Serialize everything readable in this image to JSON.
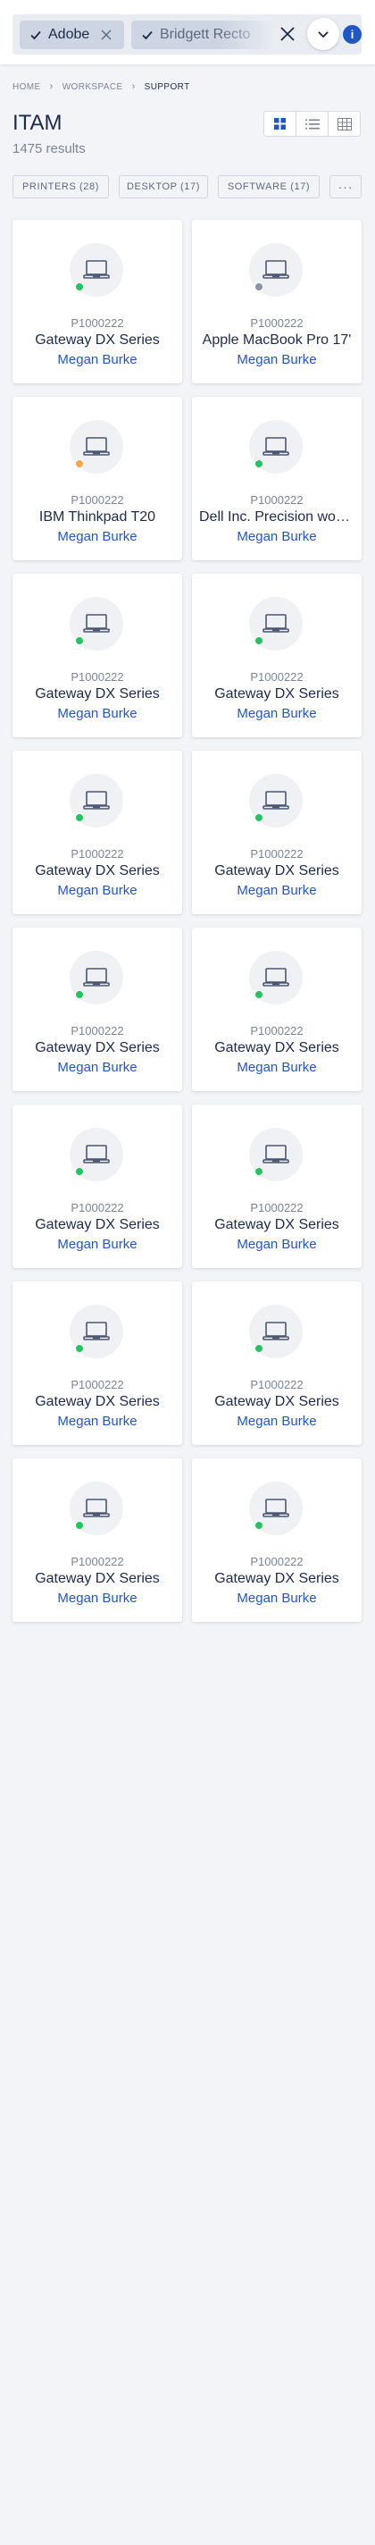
{
  "filters": {
    "chips": [
      {
        "label": "Adobe",
        "active": true
      },
      {
        "label": "Bridgett Recto",
        "active": true
      }
    ],
    "info_badge": "i",
    "icons": {
      "check": "check-icon",
      "remove": "close-icon",
      "clear_all": "close-icon",
      "expand": "chevron-down-icon"
    }
  },
  "breadcrumb": [
    "HOME",
    "WORKSPACE",
    "SUPPORT"
  ],
  "page": {
    "title": "ITAM",
    "results": "1475 results"
  },
  "view_modes": [
    "grid-view-icon",
    "list-view-icon",
    "table-view-icon"
  ],
  "categories": [
    {
      "label": "PRINTERS (28)"
    },
    {
      "label": "DESKTOP (17)"
    },
    {
      "label": "SOFTWARE (17)"
    },
    {
      "label": "···"
    }
  ],
  "colors": {
    "accent": "#1f57c5",
    "link": "#2456c2",
    "status_green": "#22c55e",
    "status_gray": "#8b93a7",
    "status_orange": "#f6a54a"
  },
  "cards": [
    {
      "id": "P1000222",
      "name": "Gateway DX Series",
      "owner": "Megan Burke",
      "status": "green"
    },
    {
      "id": "P1000222",
      "name": "Apple MacBook Pro 17'",
      "owner": "Megan Burke",
      "status": "gray"
    },
    {
      "id": "P1000222",
      "name": "IBM Thinkpad T20",
      "owner": "Megan Burke",
      "status": "orange"
    },
    {
      "id": "P1000222",
      "name": "Dell Inc. Precision workstation",
      "owner": "Megan Burke",
      "status": "green"
    },
    {
      "id": "P1000222",
      "name": "Gateway DX Series",
      "owner": "Megan Burke",
      "status": "green"
    },
    {
      "id": "P1000222",
      "name": "Gateway DX Series",
      "owner": "Megan Burke",
      "status": "green"
    },
    {
      "id": "P1000222",
      "name": "Gateway DX Series",
      "owner": "Megan Burke",
      "status": "green"
    },
    {
      "id": "P1000222",
      "name": "Gateway DX Series",
      "owner": "Megan Burke",
      "status": "green"
    },
    {
      "id": "P1000222",
      "name": "Gateway DX Series",
      "owner": "Megan Burke",
      "status": "green"
    },
    {
      "id": "P1000222",
      "name": "Gateway DX Series",
      "owner": "Megan Burke",
      "status": "green"
    },
    {
      "id": "P1000222",
      "name": "Gateway DX Series",
      "owner": "Megan Burke",
      "status": "green"
    },
    {
      "id": "P1000222",
      "name": "Gateway DX Series",
      "owner": "Megan Burke",
      "status": "green"
    },
    {
      "id": "P1000222",
      "name": "Gateway DX Series",
      "owner": "Megan Burke",
      "status": "green"
    },
    {
      "id": "P1000222",
      "name": "Gateway DX Series",
      "owner": "Megan Burke",
      "status": "green"
    },
    {
      "id": "P1000222",
      "name": "Gateway DX Series",
      "owner": "Megan Burke",
      "status": "green"
    },
    {
      "id": "P1000222",
      "name": "Gateway DX Series",
      "owner": "Megan Burke",
      "status": "green"
    }
  ]
}
